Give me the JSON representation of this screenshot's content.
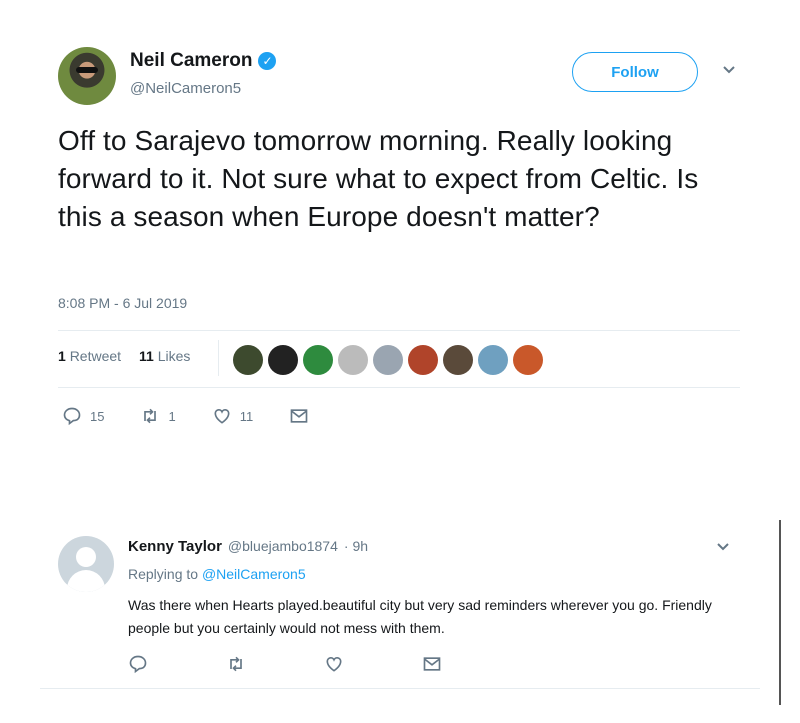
{
  "tweet": {
    "display_name": "Neil Cameron",
    "handle": "@NeilCameron5",
    "follow_label": "Follow",
    "text": "Off to Sarajevo tomorrow morning. Really looking forward to it. Not sure what to expect from Celtic. Is this a season when Europe doesn't matter?",
    "timestamp": "8:08 PM - 6 Jul 2019",
    "retweet_count": "1",
    "retweet_label": "Retweet",
    "like_count": "11",
    "like_label": "Likes",
    "actions": {
      "reply_count": "15",
      "retweet_count": "1",
      "like_count": "11"
    }
  },
  "reply": {
    "display_name": "Kenny Taylor",
    "handle": "@bluejambo1874",
    "time": "· 9h",
    "replying_prefix": "Replying to",
    "replying_to": "@NeilCameron5",
    "text": "Was there when Hearts played.beautiful city but very sad reminders wherever you go. Friendly people but you certainly would not mess with them."
  },
  "likers": [
    {
      "color": "#3d4a2e"
    },
    {
      "color": "#222222"
    },
    {
      "color": "#2e8b3e"
    },
    {
      "color": "#bbbbbb"
    },
    {
      "color": "#9aa5b1"
    },
    {
      "color": "#b0442a"
    },
    {
      "color": "#5a4a3a"
    },
    {
      "color": "#6fa0c0"
    },
    {
      "color": "#c9582a"
    }
  ],
  "colors": {
    "accent": "#1da1f2",
    "muted": "#657786",
    "text": "#14171a"
  }
}
